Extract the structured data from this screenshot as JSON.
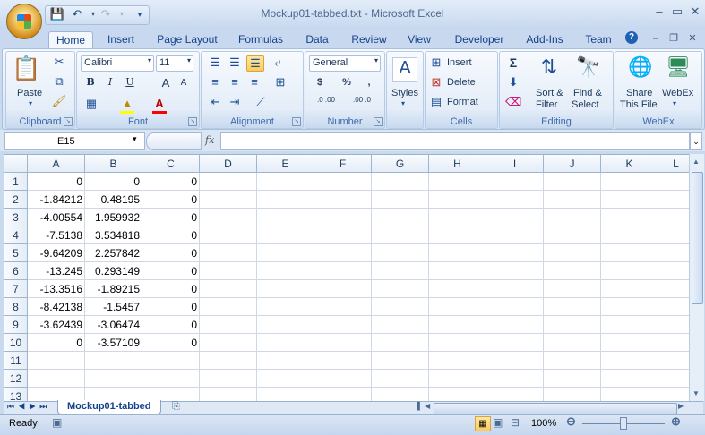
{
  "window": {
    "title": "Mockup01-tabbed.txt - Microsoft Excel"
  },
  "tabs": [
    "Home",
    "Insert",
    "Page Layout",
    "Formulas",
    "Data",
    "Review",
    "View",
    "Developer",
    "Add-Ins",
    "Team"
  ],
  "ribbon": {
    "clipboard": {
      "paste": "Paste",
      "label": "Clipboard"
    },
    "font": {
      "name": "Calibri",
      "size": "11",
      "label": "Font",
      "bold": "B",
      "italic": "I",
      "underline": "U",
      "grow": "A",
      "shrink": "A"
    },
    "alignment": {
      "label": "Alignment"
    },
    "number": {
      "format": "General",
      "currency": "$",
      "percent": "%",
      "comma": ",",
      "inc_dec": ".0 .00",
      "dec_dec": ".00 .0",
      "label": "Number"
    },
    "styles": {
      "label": "Styles"
    },
    "cells": {
      "insert": "Insert",
      "delete": "Delete",
      "format": "Format",
      "label": "Cells"
    },
    "editing": {
      "sum": "Σ",
      "sort_1": "Sort &",
      "sort_2": "Filter",
      "find_1": "Find &",
      "find_2": "Select",
      "label": "Editing"
    },
    "webex": {
      "share_1": "Share",
      "share_2": "This File",
      "webex": "WebEx",
      "label": "WebEx"
    }
  },
  "formula_bar": {
    "name_box": "E15",
    "fx": "fx",
    "value": ""
  },
  "columns": [
    "A",
    "B",
    "C",
    "D",
    "E",
    "F",
    "G",
    "H",
    "I",
    "J",
    "K",
    "L"
  ],
  "rows": [
    [
      "1",
      "0",
      "0",
      "0"
    ],
    [
      "2",
      "-1.84212",
      "0.48195",
      "0"
    ],
    [
      "3",
      "-4.00554",
      "1.959932",
      "0"
    ],
    [
      "4",
      "-7.5138",
      "3.534818",
      "0"
    ],
    [
      "5",
      "-9.64209",
      "2.257842",
      "0"
    ],
    [
      "6",
      "-13.245",
      "0.293149",
      "0"
    ],
    [
      "7",
      "-13.3516",
      "-1.89215",
      "0"
    ],
    [
      "8",
      "-8.42138",
      "-1.5457",
      "0"
    ],
    [
      "9",
      "-3.62439",
      "-3.06474",
      "0"
    ],
    [
      "10",
      "0",
      "-3.57109",
      "0"
    ],
    [
      "11",
      "",
      "",
      ""
    ],
    [
      "12",
      "",
      "",
      ""
    ],
    [
      "13",
      "",
      "",
      ""
    ]
  ],
  "sheet_tab": "Mockup01-tabbed",
  "status": {
    "ready": "Ready",
    "zoom": "100%"
  },
  "colors": {
    "ribbon_bg": "#dbe6f4",
    "tab_text": "#15428b",
    "selected_button": "#ffc95a"
  }
}
